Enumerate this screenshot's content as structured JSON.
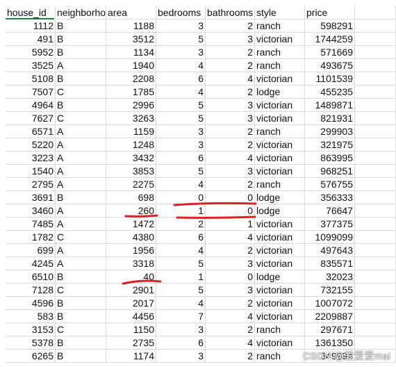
{
  "columns": [
    "house_id",
    "neighborho",
    "area",
    "bedrooms",
    "bathrooms",
    "style",
    "price"
  ],
  "rows": [
    [
      "1112",
      "B",
      "1188",
      "3",
      "2",
      "ranch",
      "598291"
    ],
    [
      "491",
      "B",
      "3512",
      "5",
      "3",
      "victorian",
      "1744259"
    ],
    [
      "5952",
      "B",
      "1134",
      "3",
      "2",
      "ranch",
      "571669"
    ],
    [
      "3525",
      "A",
      "1940",
      "4",
      "2",
      "ranch",
      "493675"
    ],
    [
      "5108",
      "B",
      "2208",
      "6",
      "4",
      "victorian",
      "1101539"
    ],
    [
      "7507",
      "C",
      "1785",
      "4",
      "2",
      "lodge",
      "455235"
    ],
    [
      "4964",
      "B",
      "2996",
      "5",
      "3",
      "victorian",
      "1489871"
    ],
    [
      "7627",
      "C",
      "3263",
      "5",
      "3",
      "victorian",
      "821931"
    ],
    [
      "6571",
      "A",
      "1159",
      "3",
      "2",
      "ranch",
      "299903"
    ],
    [
      "5220",
      "A",
      "1248",
      "3",
      "2",
      "victorian",
      "321975"
    ],
    [
      "3223",
      "A",
      "3432",
      "6",
      "4",
      "victorian",
      "863995"
    ],
    [
      "1540",
      "A",
      "3853",
      "5",
      "3",
      "victorian",
      "968251"
    ],
    [
      "2795",
      "A",
      "2275",
      "4",
      "2",
      "ranch",
      "576755"
    ],
    [
      "3691",
      "B",
      "698",
      "0",
      "0",
      "lodge",
      "356333"
    ],
    [
      "3460",
      "A",
      "260",
      "1",
      "0",
      "lodge",
      "76647"
    ],
    [
      "7485",
      "A",
      "1472",
      "2",
      "1",
      "victorian",
      "377375"
    ],
    [
      "1782",
      "C",
      "4380",
      "6",
      "4",
      "victorian",
      "1099099"
    ],
    [
      "699",
      "A",
      "1956",
      "4",
      "2",
      "victorian",
      "497643"
    ],
    [
      "4245",
      "A",
      "3318",
      "5",
      "3",
      "victorian",
      "835571"
    ],
    [
      "6510",
      "B",
      "40",
      "1",
      "0",
      "lodge",
      "32023"
    ],
    [
      "7128",
      "C",
      "2901",
      "5",
      "3",
      "victorian",
      "732155"
    ],
    [
      "4596",
      "B",
      "2017",
      "4",
      "2",
      "victorian",
      "1007072"
    ],
    [
      "583",
      "B",
      "4456",
      "7",
      "4",
      "victorian",
      "2209887"
    ],
    [
      "3153",
      "C",
      "1150",
      "3",
      "2",
      "ranch",
      "297671"
    ],
    [
      "5378",
      "B",
      "2735",
      "6",
      "4",
      "victorian",
      "1361350"
    ],
    [
      "6265",
      "B",
      "1174",
      "3",
      "2",
      "ranch",
      "349994"
    ]
  ],
  "watermark": "CSDN @爱爱爱mai",
  "colors": {
    "annotation": "#e02020",
    "grid": "#d9d9d9",
    "selection": "#1a7f3c"
  }
}
